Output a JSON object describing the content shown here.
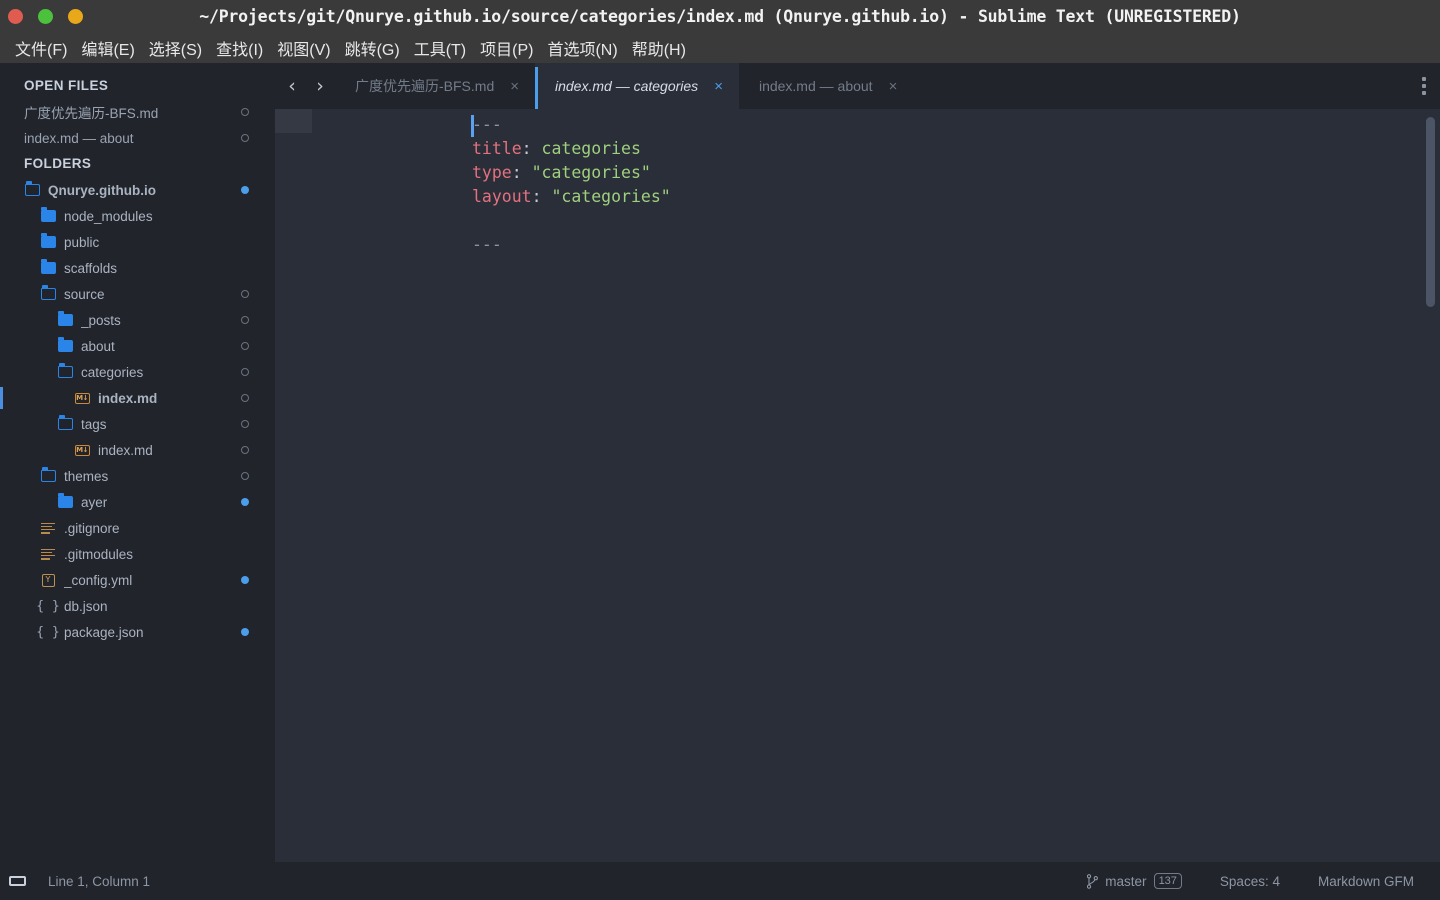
{
  "window": {
    "title": "~/Projects/git/Qnurye.github.io/source/categories/index.md (Qnurye.github.io) - Sublime Text (UNREGISTERED)",
    "traffic_lights": [
      {
        "name": "close",
        "color": "#e05c51"
      },
      {
        "name": "minimize",
        "color": "#4cc13c"
      },
      {
        "name": "maximize",
        "color": "#e9a81a"
      }
    ]
  },
  "menubar": {
    "items": [
      {
        "label": "文件(F)"
      },
      {
        "label": "编辑(E)"
      },
      {
        "label": "选择(S)"
      },
      {
        "label": "查找(I)"
      },
      {
        "label": "视图(V)"
      },
      {
        "label": "跳转(G)"
      },
      {
        "label": "工具(T)"
      },
      {
        "label": "项目(P)"
      },
      {
        "label": "首选项(N)"
      },
      {
        "label": "帮助(H)"
      }
    ]
  },
  "sidebar": {
    "open_files_header": "OPEN FILES",
    "open_files": [
      {
        "label": "广度优先遍历-BFS.md",
        "status": "hollow"
      },
      {
        "label": "index.md — about",
        "status": "hollow"
      }
    ],
    "folders_header": "FOLDERS",
    "tree": [
      {
        "label": "Qnurye.github.io",
        "icon": "folder-open",
        "indent": 0,
        "bold": true,
        "status": "filled"
      },
      {
        "label": "node_modules",
        "icon": "folder-closed",
        "indent": 1,
        "bold": false,
        "status": "none"
      },
      {
        "label": "public",
        "icon": "folder-closed",
        "indent": 1,
        "bold": false,
        "status": "none"
      },
      {
        "label": "scaffolds",
        "icon": "folder-closed",
        "indent": 1,
        "bold": false,
        "status": "none"
      },
      {
        "label": "source",
        "icon": "folder-open",
        "indent": 1,
        "bold": false,
        "status": "hollow"
      },
      {
        "label": "_posts",
        "icon": "folder-closed",
        "indent": 2,
        "bold": false,
        "status": "hollow"
      },
      {
        "label": "about",
        "icon": "folder-closed",
        "indent": 2,
        "bold": false,
        "status": "hollow"
      },
      {
        "label": "categories",
        "icon": "folder-open",
        "indent": 2,
        "bold": false,
        "status": "hollow"
      },
      {
        "label": "index.md",
        "icon": "markdown",
        "indent": 3,
        "bold": true,
        "status": "hollow",
        "active": true
      },
      {
        "label": "tags",
        "icon": "folder-open",
        "indent": 2,
        "bold": false,
        "status": "hollow"
      },
      {
        "label": "index.md",
        "icon": "markdown",
        "indent": 3,
        "bold": false,
        "status": "hollow"
      },
      {
        "label": "themes",
        "icon": "folder-open",
        "indent": 1,
        "bold": false,
        "status": "hollow"
      },
      {
        "label": "ayer",
        "icon": "folder-closed",
        "indent": 2,
        "bold": false,
        "status": "filled"
      },
      {
        "label": ".gitignore",
        "icon": "lines",
        "indent": 1,
        "bold": false,
        "status": "none"
      },
      {
        "label": ".gitmodules",
        "icon": "lines",
        "indent": 1,
        "bold": false,
        "status": "none"
      },
      {
        "label": "_config.yml",
        "icon": "yml",
        "indent": 1,
        "bold": false,
        "status": "filled"
      },
      {
        "label": "db.json",
        "icon": "json",
        "indent": 1,
        "bold": false,
        "status": "none"
      },
      {
        "label": "package.json",
        "icon": "json",
        "indent": 1,
        "bold": false,
        "status": "filled"
      }
    ]
  },
  "tabbar": {
    "nav_back": "‹",
    "nav_forward": "›",
    "close_glyph": "×",
    "menu_icon": "overflow-menu-icon",
    "tabs": [
      {
        "label": "广度优先遍历-BFS.md",
        "active": false
      },
      {
        "label": "index.md — categories",
        "active": true
      },
      {
        "label": "index.md — about",
        "active": false
      }
    ]
  },
  "editor": {
    "language": "Markdown GFM",
    "lines": [
      {
        "type": "rule",
        "text": "---"
      },
      {
        "type": "pair",
        "key": "title",
        "colon": ":",
        "value": " categories"
      },
      {
        "type": "pair",
        "key": "type",
        "colon": ":",
        "value": " \"categories\""
      },
      {
        "type": "pair",
        "key": "layout",
        "colon": ":",
        "value": " \"categories\""
      },
      {
        "type": "blank",
        "text": ""
      },
      {
        "type": "rule",
        "text": "---"
      }
    ],
    "colors": {
      "background": "#2a2e38",
      "rule": "#8a93a3",
      "key": "#e4717f",
      "punctuation": "#c5cbd6",
      "value": "#9fd07e",
      "caret": "#5aa2f0"
    }
  },
  "statusbar": {
    "sidebar_toggle_icon": "sidebar-toggle-icon",
    "caret_position": "Line 1, Column 1",
    "git_icon": "git-branch-icon",
    "branch": "master",
    "branch_count": "137",
    "indentation": "Spaces: 4",
    "syntax": "Markdown GFM"
  }
}
